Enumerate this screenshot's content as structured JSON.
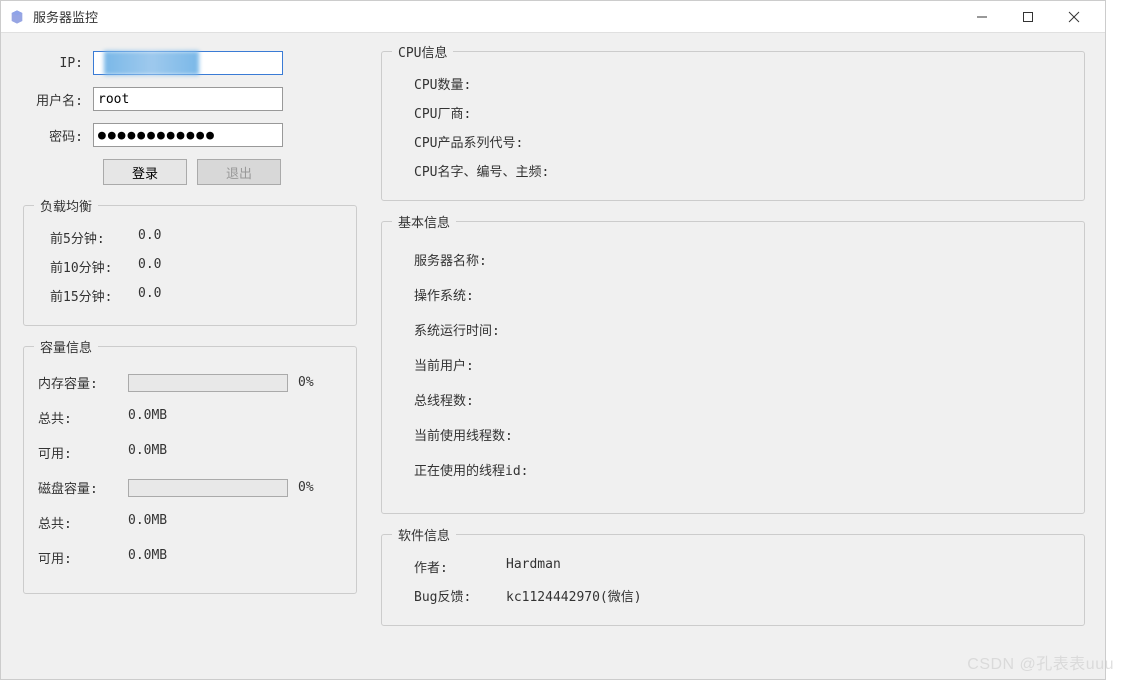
{
  "window": {
    "title": "服务器监控"
  },
  "login": {
    "ip_label": "IP:",
    "ip_value": "",
    "user_label": "用户名:",
    "user_value": "root",
    "pass_label": "密码:",
    "pass_value": "●●●●●●●●●●●●",
    "login_btn": "登录",
    "exit_btn": "退出"
  },
  "load": {
    "legend": "负载均衡",
    "rows": [
      {
        "label": "前5分钟:",
        "value": "0.0"
      },
      {
        "label": "前10分钟:",
        "value": "0.0"
      },
      {
        "label": "前15分钟:",
        "value": "0.0"
      }
    ]
  },
  "capacity": {
    "legend": "容量信息",
    "mem_label": "内存容量:",
    "mem_pct": "0%",
    "mem_total_label": "总共:",
    "mem_total_value": "0.0MB",
    "mem_avail_label": "可用:",
    "mem_avail_value": "0.0MB",
    "disk_label": "磁盘容量:",
    "disk_pct": "0%",
    "disk_total_label": "总共:",
    "disk_total_value": "0.0MB",
    "disk_avail_label": "可用:",
    "disk_avail_value": "0.0MB"
  },
  "cpu": {
    "legend": "CPU信息",
    "rows": [
      {
        "label": "CPU数量:"
      },
      {
        "label": "CPU厂商:"
      },
      {
        "label": "CPU产品系列代号:"
      },
      {
        "label": "CPU名字、编号、主频:"
      }
    ]
  },
  "basic": {
    "legend": "基本信息",
    "rows": [
      {
        "label": "服务器名称:"
      },
      {
        "label": "操作系统:"
      },
      {
        "label": "系统运行时间:"
      },
      {
        "label": "当前用户:"
      },
      {
        "label": "总线程数:"
      },
      {
        "label": "当前使用线程数:"
      },
      {
        "label": "正在使用的线程id:"
      }
    ]
  },
  "software": {
    "legend": "软件信息",
    "author_label": "作者:",
    "author_value": "Hardman",
    "bug_label": "Bug反馈:",
    "bug_value": "kc1124442970(微信)"
  },
  "watermark": "CSDN @孔表表uuu"
}
